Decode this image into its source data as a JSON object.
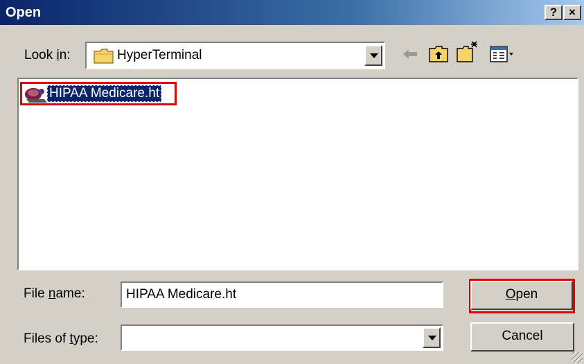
{
  "window": {
    "title": "Open"
  },
  "titlebar": {
    "help_label": "?",
    "close_label": "×"
  },
  "look_in": {
    "label_pre": "Look ",
    "label_key": "i",
    "label_post": "n:",
    "value": "HyperTerminal",
    "icon": "folder-icon"
  },
  "toolbar": {
    "icons": [
      "back-arrow-icon",
      "up-folder-icon",
      "new-folder-icon",
      "view-menu-icon"
    ]
  },
  "files": [
    {
      "name": "HIPAA Medicare.ht",
      "icon": "hyperterminal-file-icon",
      "selected": true
    }
  ],
  "file_name": {
    "label_pre": "File ",
    "label_key": "n",
    "label_post": "ame:",
    "value": "HIPAA Medicare.ht"
  },
  "file_type": {
    "label_pre": "Files of ",
    "label_key": "t",
    "label_post": "ype:",
    "value": ""
  },
  "buttons": {
    "open_key": "O",
    "open_rest": "pen",
    "cancel": "Cancel"
  },
  "colors": {
    "title_bar": "#0a246a",
    "selection": "#0a246a",
    "highlight_box": "#e00000",
    "dialog_face": "#d4d0c8"
  }
}
